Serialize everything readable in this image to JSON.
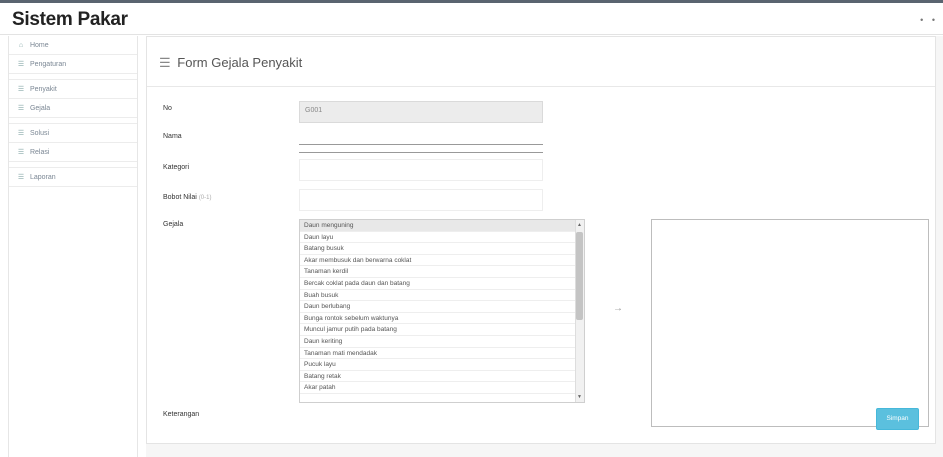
{
  "app": {
    "brand": "Sistem Pakar",
    "top_icons": [
      "•",
      "•"
    ]
  },
  "sidebar": {
    "items": [
      {
        "icon": "⌂",
        "label": "Home"
      },
      {
        "icon": "☰",
        "label": "Pengaturan"
      },
      {
        "icon": "☰",
        "label": "Penyakit"
      },
      {
        "icon": "☰",
        "label": "Gejala"
      },
      {
        "icon": "☰",
        "label": "Solusi"
      },
      {
        "icon": "☰",
        "label": "Relasi"
      },
      {
        "icon": "☰",
        "label": "Laporan"
      }
    ]
  },
  "form": {
    "title": "Form Gejala Penyakit",
    "title_icon": "☰",
    "labels": {
      "no": "No",
      "nama": "Nama",
      "kategori": "Kategori",
      "bobot": "Bobot Nilai",
      "gejala": "Gejala",
      "keterangan": "Keterangan"
    },
    "no_value": "G001",
    "bobot_hint": "(0-1)",
    "gejala_options": [
      "Daun menguning",
      "Daun layu",
      "Batang busuk",
      "Akar membusuk dan berwarna coklat",
      "Tanaman kerdil",
      "Bercak coklat pada daun dan batang",
      "Buah busuk",
      "Daun berlubang",
      "Bunga rontok sebelum waktunya",
      "Muncul jamur putih pada batang",
      "Daun keriting",
      "Tanaman mati mendadak",
      "Pucuk layu",
      "Batang retak",
      "Akar patah"
    ],
    "transfer_arrow": "→",
    "save_label": "Simpan"
  }
}
